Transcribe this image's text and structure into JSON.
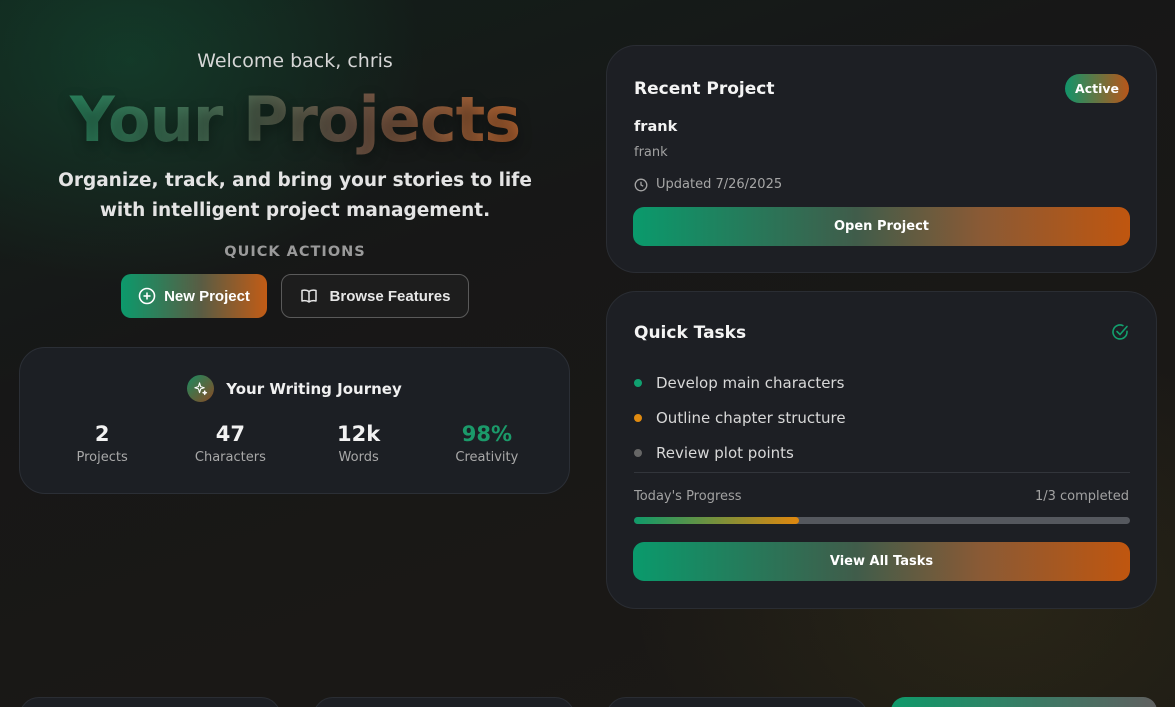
{
  "hero": {
    "welcome": "Welcome back, chris",
    "title": "Your Projects",
    "subtitle": "Organize, track, and bring your stories to life with intelligent project management.",
    "quick_actions_label": "QUICK ACTIONS",
    "new_project_label": "New Project",
    "browse_features_label": "Browse Features"
  },
  "journey": {
    "title": "Your Writing Journey",
    "stats": [
      {
        "value": "2",
        "label": "Projects"
      },
      {
        "value": "47",
        "label": "Characters"
      },
      {
        "value": "12k",
        "label": "Words"
      },
      {
        "value": "98%",
        "label": "Creativity"
      }
    ]
  },
  "recent_project": {
    "title": "Recent Project",
    "badge": "Active",
    "name": "frank",
    "description": "frank",
    "updated": "Updated 7/26/2025",
    "open_label": "Open Project"
  },
  "quick_tasks": {
    "title": "Quick Tasks",
    "tasks": [
      {
        "label": "Develop main characters",
        "color": "#10a070"
      },
      {
        "label": "Outline chapter structure",
        "color": "#e08a10"
      },
      {
        "label": "Review plot points",
        "color": "#666666"
      }
    ],
    "progress_label": "Today's Progress",
    "progress_count": "1/3 completed",
    "progress_fraction": 0.333,
    "view_all_label": "View All Tasks"
  },
  "colors": {
    "accent_green": "#0c9a6c",
    "accent_orange": "#c25c16",
    "creativity_green": "#1b9a6a"
  },
  "icons": {
    "new_project": "plus-circle-icon",
    "browse_features": "book-open-icon",
    "journey": "sparkles-icon",
    "updated": "clock-icon",
    "tasks_header": "check-circle-icon"
  }
}
